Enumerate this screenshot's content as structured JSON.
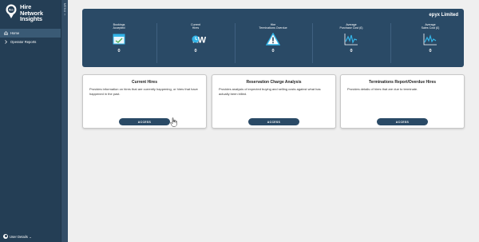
{
  "brand": {
    "name_line1": "Hire",
    "name_line2": "Network",
    "name_line3": "Insights",
    "badge": "flex"
  },
  "sidebar": {
    "items": [
      {
        "label": "Home",
        "icon": "home-icon",
        "active": true
      },
      {
        "label": "Operator Reports",
        "icon": "chevron-right-icon",
        "active": false
      }
    ],
    "user_label": "User Details",
    "user_chevron": "⌄"
  },
  "menu_rail": {
    "label": "MENU ‹‹"
  },
  "stats": {
    "company": "epyx Limited",
    "items": [
      {
        "label_line1": "Bookings",
        "label_line2": "Accepted",
        "value": "0",
        "icon": "calendar-check-icon"
      },
      {
        "label_line1": "Current",
        "label_line2": "Hires",
        "value": "0",
        "icon": "now-icon"
      },
      {
        "label_line1": "Hire",
        "label_line2": "Terminations Overdue",
        "value": "0",
        "icon": "warning-icon"
      },
      {
        "label_line1": "Average",
        "label_line2": "Purchase Cost (£)",
        "value": "0",
        "icon": "pulse-chart-icon"
      },
      {
        "label_line1": "Average",
        "label_line2": "Sales Cost (£)",
        "value": "0",
        "icon": "pulse-chart-icon"
      }
    ]
  },
  "cards": [
    {
      "title": "Current Hires",
      "description": "Provides information on hires that are currently happening, or hires that have happened in the past.",
      "button": "ACCESS"
    },
    {
      "title": "Reservation Charge Analysis",
      "description": "Provides analysis of expected buying and selling costs against what has actually been billed.",
      "button": "ACCESS"
    },
    {
      "title": "Terminations Report/Overdue Hires",
      "description": "Provides details of hires that are due to terminate.",
      "button": "ACCESS"
    }
  ],
  "colors": {
    "sidebar": "#243e55",
    "panel": "#2a4a66",
    "accent": "#33b5e8"
  }
}
